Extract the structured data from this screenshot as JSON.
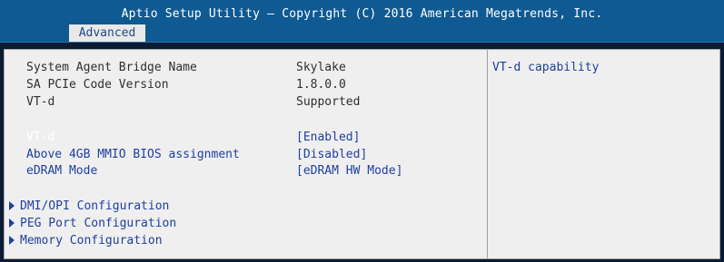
{
  "header": {
    "title": "Aptio Setup Utility – Copyright (C) 2016 American Megatrends, Inc.",
    "tab": "Advanced"
  },
  "info": [
    {
      "label": "System Agent Bridge Name",
      "value": "Skylake"
    },
    {
      "label": "SA PCIe Code Version",
      "value": "1.8.0.0"
    },
    {
      "label": "VT-d",
      "value": "Supported"
    }
  ],
  "settings": [
    {
      "label": "VT-d",
      "value": "[Enabled]"
    },
    {
      "label": "Above 4GB MMIO BIOS assignment",
      "value": "[Disabled]"
    },
    {
      "label": "eDRAM Mode",
      "value": "[eDRAM HW Mode]"
    }
  ],
  "submenus": [
    {
      "label": "DMI/OPI Configuration"
    },
    {
      "label": "PEG Port Configuration"
    },
    {
      "label": "Memory Configuration"
    }
  ],
  "help": {
    "text": "VT-d capability"
  }
}
